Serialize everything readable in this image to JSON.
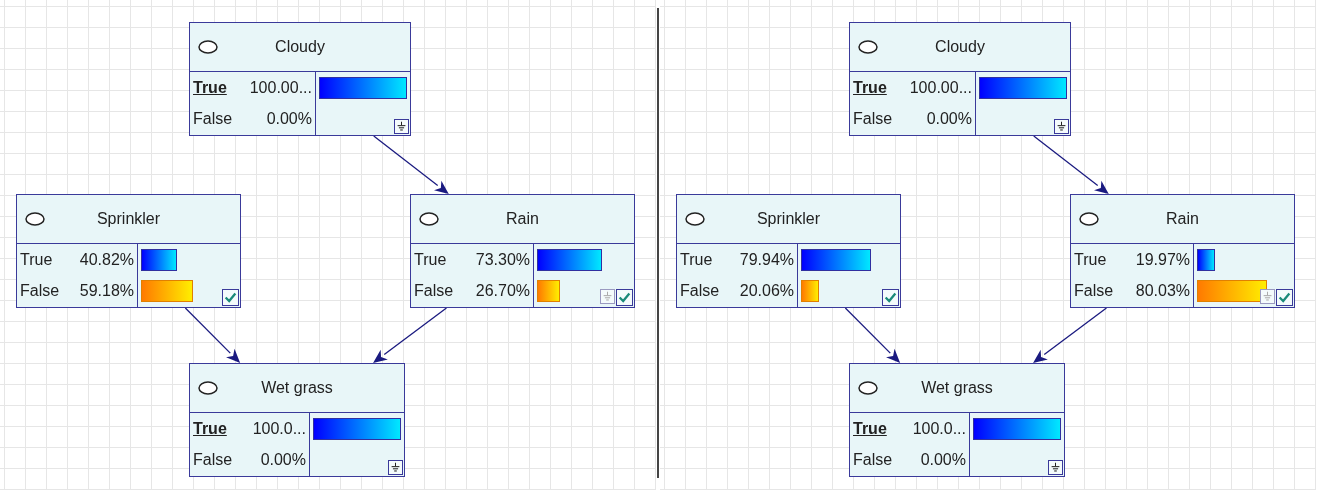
{
  "panels": [
    {
      "nodes": [
        {
          "name": "Cloudy",
          "evidence": true,
          "evidence_disabled": false,
          "verified": false,
          "states": [
            {
              "label": "True",
              "value": "100.00...",
              "observed": true
            },
            {
              "label": "False",
              "value": "0.00%",
              "observed": false
            }
          ]
        },
        {
          "name": "Sprinkler",
          "evidence": false,
          "evidence_disabled": false,
          "verified": true,
          "states": [
            {
              "label": "True",
              "value": "40.82%",
              "observed": false
            },
            {
              "label": "False",
              "value": "59.18%",
              "observed": false
            }
          ]
        },
        {
          "name": "Rain",
          "evidence": true,
          "evidence_disabled": true,
          "verified": true,
          "states": [
            {
              "label": "True",
              "value": "73.30%",
              "observed": false
            },
            {
              "label": "False",
              "value": "26.70%",
              "observed": false
            }
          ]
        },
        {
          "name": "Wet grass",
          "evidence": true,
          "evidence_disabled": false,
          "verified": false,
          "states": [
            {
              "label": "True",
              "value": "100.0...",
              "observed": true
            },
            {
              "label": "False",
              "value": "0.00%",
              "observed": false
            }
          ]
        }
      ]
    },
    {
      "nodes": [
        {
          "name": "Cloudy",
          "evidence": true,
          "evidence_disabled": false,
          "verified": false,
          "states": [
            {
              "label": "True",
              "value": "100.00...",
              "observed": true
            },
            {
              "label": "False",
              "value": "0.00%",
              "observed": false
            }
          ]
        },
        {
          "name": "Sprinkler",
          "evidence": false,
          "evidence_disabled": false,
          "verified": true,
          "states": [
            {
              "label": "True",
              "value": "79.94%",
              "observed": false
            },
            {
              "label": "False",
              "value": "20.06%",
              "observed": false
            }
          ]
        },
        {
          "name": "Rain",
          "evidence": true,
          "evidence_disabled": true,
          "verified": true,
          "states": [
            {
              "label": "True",
              "value": "19.97%",
              "observed": false
            },
            {
              "label": "False",
              "value": "80.03%",
              "observed": false
            }
          ]
        },
        {
          "name": "Wet grass",
          "evidence": true,
          "evidence_disabled": false,
          "verified": false,
          "states": [
            {
              "label": "True",
              "value": "100.0...",
              "observed": true
            },
            {
              "label": "False",
              "value": "0.00%",
              "observed": false
            }
          ]
        }
      ]
    }
  ]
}
